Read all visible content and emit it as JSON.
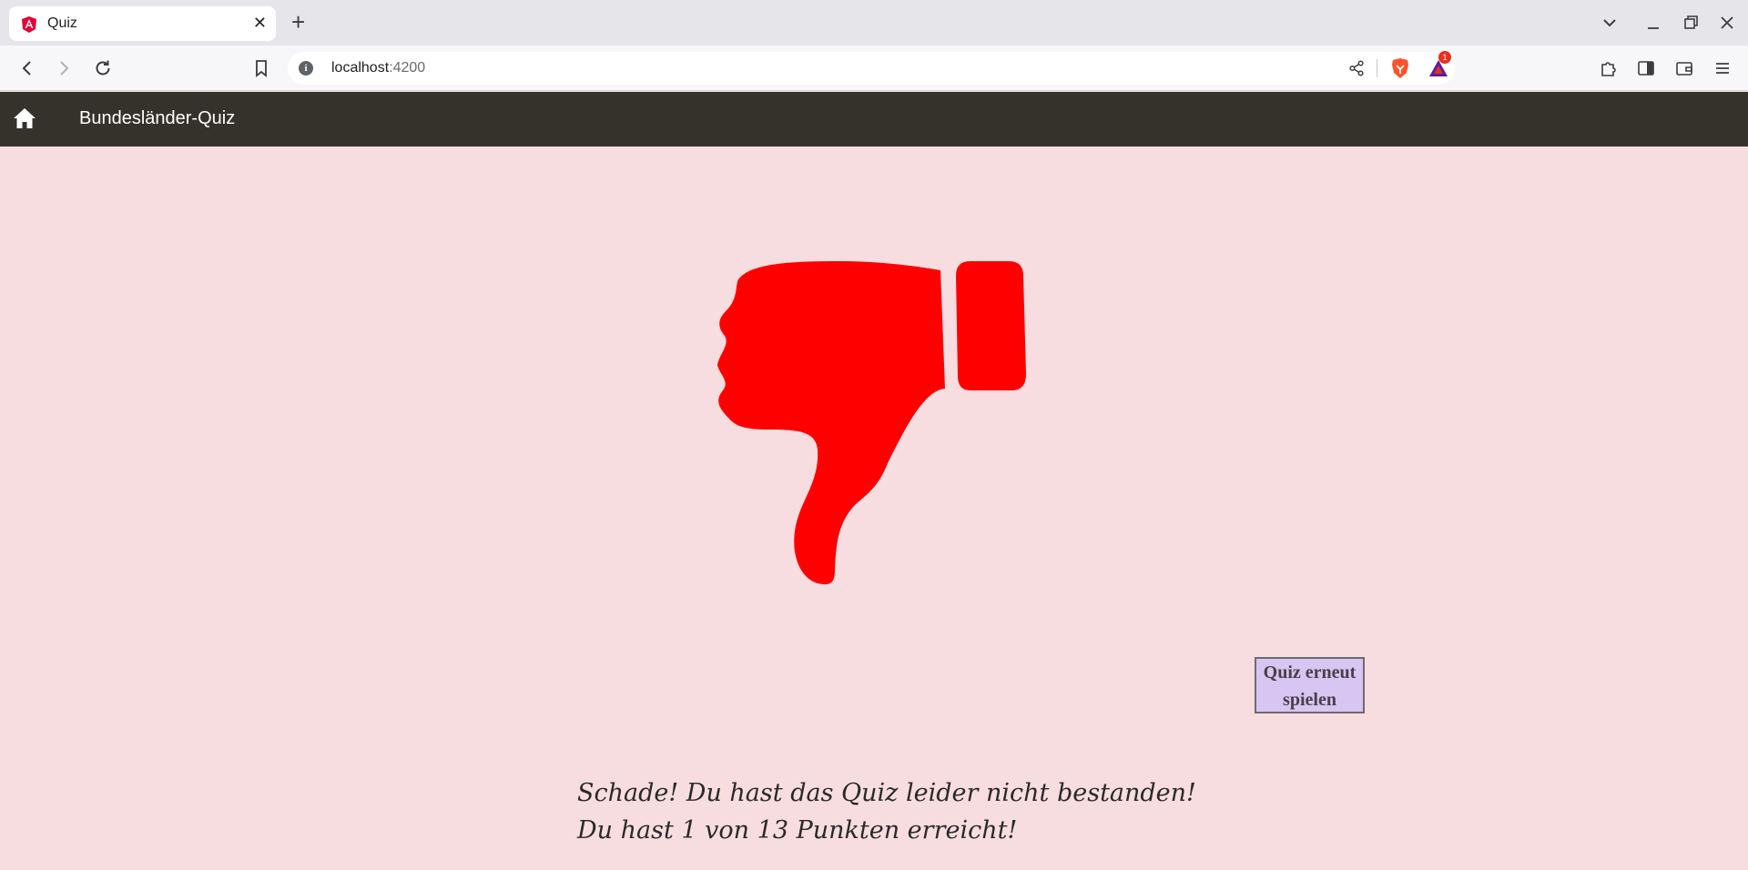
{
  "browser": {
    "tab": {
      "title": "Quiz",
      "favicon": "angular-icon"
    },
    "address": {
      "host": "localhost",
      "port": ":4200"
    },
    "notification_count": "1"
  },
  "app": {
    "title": "Bundesländer-Quiz",
    "home_icon": "home-icon"
  },
  "result": {
    "image": "thumbs-down-icon",
    "image_color": "#ff0000",
    "retry_label": "Quiz erneut spielen",
    "message_line1": "Schade! Du hast das Quiz leider nicht bestanden!",
    "message_line2": "Du hast 1 von 13 Punkten erreicht!"
  },
  "colors": {
    "page_background": "#f8dde0",
    "header_background": "#35312b",
    "button_background": "#d9c5f2"
  }
}
